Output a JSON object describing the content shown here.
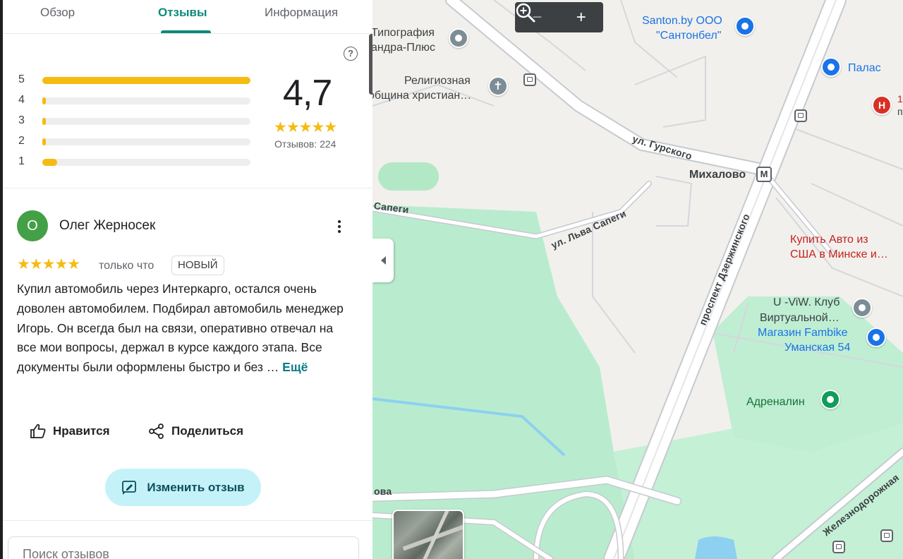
{
  "tabs": [
    {
      "label": "Обзор"
    },
    {
      "label": "Отзывы",
      "active": true
    },
    {
      "label": "Информация"
    }
  ],
  "rating": {
    "average": "4,7",
    "stars": "★★★★★",
    "count_text": "Отзывов: 224",
    "distribution": [
      {
        "stars": "5",
        "fraction": 1.0
      },
      {
        "stars": "4",
        "fraction": 0.01
      },
      {
        "stars": "3",
        "fraction": 0.005
      },
      {
        "stars": "2",
        "fraction": 0.005
      },
      {
        "stars": "1",
        "fraction": 0.07
      }
    ],
    "help_icon": "?"
  },
  "review": {
    "avatar_letter": "О",
    "author": "Олег Жерносек",
    "stars": "★★★★★",
    "time": "только что",
    "badge": "НОВЫЙ",
    "text": "Купил автомобиль через Интеркарго, остался очень доволен автомобилем. Подбирал автомобиль менеджер Игорь. Он всегда был на связи, оперативно отвечал на все мои вопросы, держал в курсе каждого этапа. Все документы были оформлены быстро и без …",
    "more": "Ещё",
    "like_label": "Нравится",
    "share_label": "Поделиться",
    "edit_label": "Изменить отзыв"
  },
  "search": {
    "placeholder": "Поиск отзывов"
  },
  "zoom": {
    "minus": "−",
    "plus": "+"
  },
  "map": {
    "labels": {
      "tipografia": "Типография",
      "alexandra": "андра-Плюс",
      "religious": "Религиозная",
      "community": "община христиан…",
      "santon1": "Santon.by ООО",
      "santon2": "\"Сантонбел\"",
      "palas": "Палас",
      "mikhalovo": "Михалово",
      "kupit1": "Купить Авто из",
      "kupit2": "США в Минске и…",
      "uviw1": "U -ViW. Клуб",
      "uviw2": "Виртуальной…",
      "fambike1": "Магазин Fambike",
      "fambike2": "Уманская 54",
      "adrenalin": "Адреналин",
      "edge_ova": "ова",
      "edge_1": "1",
      "edge_p": "п"
    },
    "roads": {
      "gurskogo": "ул. Гурского",
      "sapegi": "ул. Льва Сапеги",
      "sapegi_left": "Сапеги",
      "dzerzhinskogo": "проспект Дзержинского",
      "railway": "Железнодорожная"
    },
    "metro_letter": "М",
    "hospital_letter": "H"
  }
}
